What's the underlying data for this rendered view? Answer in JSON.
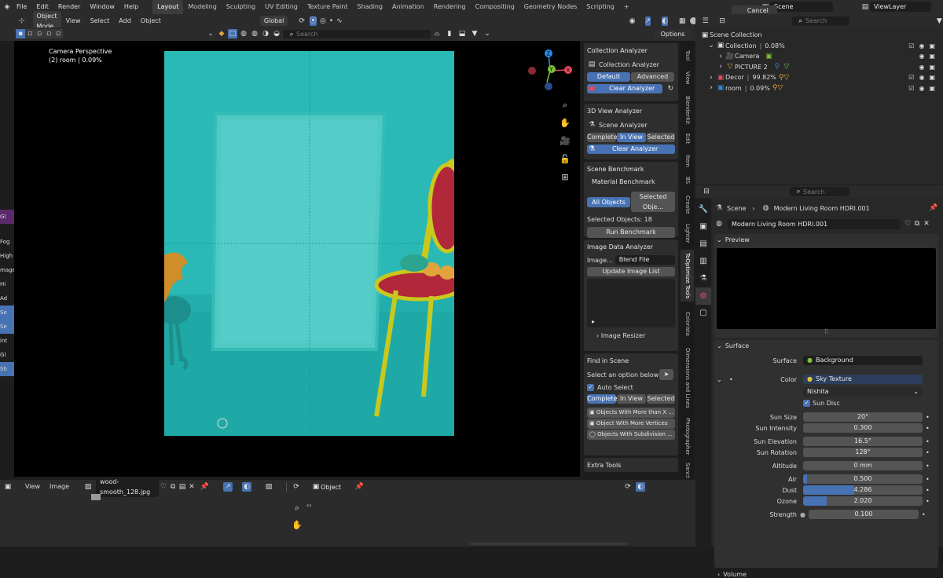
{
  "topbar": {
    "menus": [
      "File",
      "Edit",
      "Render",
      "Window",
      "Help"
    ],
    "workspace_tabs": [
      "Layout",
      "Modeling",
      "Sculpting",
      "UV Editing",
      "Texture Paint",
      "Shading",
      "Animation",
      "Rendering",
      "Compositing",
      "Geometry Nodes",
      "Scripting"
    ],
    "active_tab": "Layout",
    "scene": "Scene",
    "view_layer": "ViewLayer"
  },
  "viewport_header": {
    "mode": "Object Mode",
    "menus": [
      "View",
      "Select",
      "Add",
      "Object"
    ],
    "transform": "Global",
    "cancel_af": "Cancel AF Tracking",
    "search_placeholder": "Search",
    "options": "Options"
  },
  "viewport": {
    "title": "Camera Perspective",
    "subtitle": "(2) room | 0.09%",
    "gizmo": {
      "x": "X",
      "y": "Y",
      "z": "Z"
    }
  },
  "left_cut_labels": [
    "Gl",
    "Fog",
    "High",
    "mage",
    "Hi",
    "Ad",
    "Se",
    "Se",
    "int",
    "Gl",
    "Sh"
  ],
  "npanel": {
    "collection_analyzer": {
      "title": "Collection Analyzer",
      "label": "Collection Analyzer",
      "tab1": "Default",
      "tab2": "Advanced",
      "clear": "Clear Analyzer"
    },
    "view3d_analyzer": {
      "title": "3D View Analyzer",
      "label": "Scene Analyzer",
      "tabs": [
        "Complete",
        "In View",
        "Selected"
      ],
      "clear": "Clear Analyzer"
    },
    "scene_benchmark": {
      "title": "Scene Benchmark",
      "sub": "Material Benchmark",
      "tab1": "All Objects",
      "tab2": "Selected Obje...",
      "selected": "Selected Objects: 18",
      "run": "Run Benchmark"
    },
    "image_data": {
      "title": "Image Data Analyzer",
      "label": "Image...",
      "value": "Blend File",
      "update": "Update Image List",
      "resizer": "Image Resizer"
    },
    "find_scene": {
      "title": "Find in Scene",
      "select": "Select an option below",
      "auto": "Auto Select",
      "tabs": [
        "Complete",
        "In View",
        "Selected"
      ],
      "opts": [
        "Objects With More than X ...",
        "Object With More Vertices",
        "Objects With Subdivision ..."
      ]
    },
    "extra": "Extra Tools"
  },
  "vtabs": [
    "Tool",
    "View",
    "BlenderKit",
    "Edit",
    "Item",
    "BS",
    "Create",
    "Lighter",
    "ToOptimize Tools",
    "Colorista",
    "Dimensions and Lines",
    "Photographer",
    "Sanct"
  ],
  "outliner": {
    "search_placeholder": "Search",
    "root": "Scene Collection",
    "items": [
      {
        "name": "Collection",
        "pct": "0.08%"
      },
      {
        "name": "Camera",
        "pct": ""
      },
      {
        "name": "PICTURE 2",
        "pct": ""
      },
      {
        "name": "Decor",
        "pct": "99.82%"
      },
      {
        "name": "room",
        "pct": "0.09%"
      }
    ]
  },
  "properties": {
    "search_placeholder": "Search",
    "breadcrumb_scene": "Scene",
    "breadcrumb_world": "Modern Living Room HDRI.001",
    "world_name": "Modern Living Room HDRI.001",
    "preview": "Preview",
    "surface": "Surface",
    "surface_label": "Surface",
    "surface_value": "Background",
    "color_label": "Color",
    "color_value": "Sky Texture",
    "sky_type": "Nishita",
    "sun_disc": "Sun Disc",
    "fields": [
      {
        "label": "Sun Size",
        "value": "20°"
      },
      {
        "label": "Sun Intensity",
        "value": "0.300"
      },
      {
        "label": "Sun Elevation",
        "value": "16.5°"
      },
      {
        "label": "Sun Rotation",
        "value": "128°"
      },
      {
        "label": "Altitude",
        "value": "0 mm"
      },
      {
        "label": "Air",
        "value": "0.500",
        "fill": 0.03
      },
      {
        "label": "Dust",
        "value": "4.286",
        "fill": 0.43
      },
      {
        "label": "Ozone",
        "value": "2.020",
        "fill": 0.2
      },
      {
        "label": "Strength",
        "value": "0.100"
      }
    ],
    "volume": "Volume"
  },
  "image_editor": {
    "menus": [
      "View",
      "Image"
    ],
    "image_name": "wood-smooth_128.jpg",
    "mode": "Object"
  },
  "colors": {
    "accent": "#4772b3",
    "teal": "#27b4b1",
    "yellow": "#c9c81e",
    "red": "#b0283a"
  }
}
